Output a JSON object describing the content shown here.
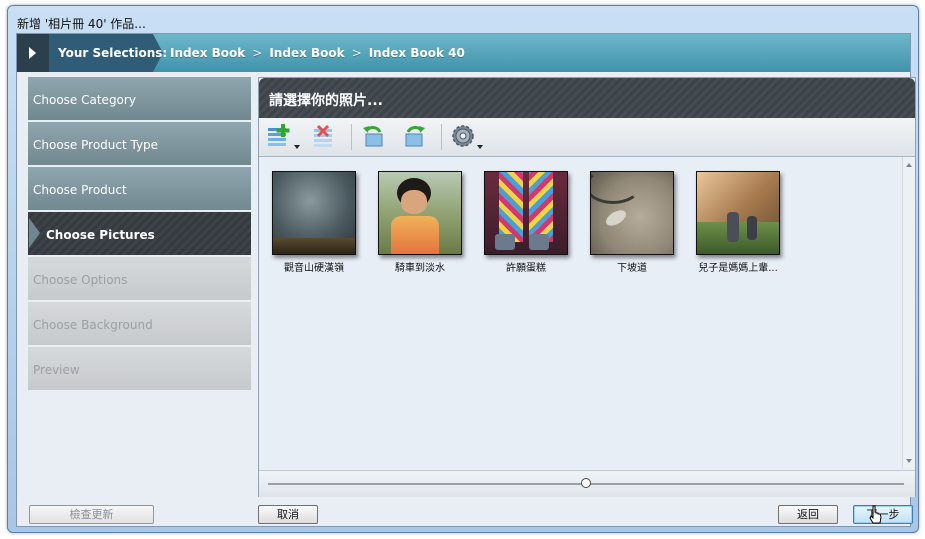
{
  "window": {
    "title": "新增 '相片冊 40' 作品..."
  },
  "breadcrumb": {
    "label": "Your Selections:",
    "items": [
      "Index Book",
      "Index Book",
      "Index Book 40"
    ],
    "separator": ">"
  },
  "sidebar": {
    "steps": [
      {
        "label": "Choose Category",
        "state": "done"
      },
      {
        "label": "Choose Product Type",
        "state": "done"
      },
      {
        "label": "Choose Product",
        "state": "done"
      },
      {
        "label": "Choose Pictures",
        "state": "current"
      },
      {
        "label": "Choose Options",
        "state": "future"
      },
      {
        "label": "Choose Background",
        "state": "future"
      },
      {
        "label": "Preview",
        "state": "future"
      }
    ],
    "check_update_label": "檢查更新"
  },
  "panel": {
    "title": "請選擇你的照片...",
    "toolbar": {
      "icons": [
        "add-photo-icon",
        "remove-photo-icon",
        "rotate-left-icon",
        "rotate-right-icon",
        "settings-gear-icon"
      ]
    },
    "photos": [
      {
        "caption": "觀音山硬漢嶺"
      },
      {
        "caption": "騎車到淡水"
      },
      {
        "caption": "許願蛋糕"
      },
      {
        "caption": "下坡道"
      },
      {
        "caption": "兒子是媽媽上輩..."
      }
    ]
  },
  "buttons": {
    "cancel": "取消",
    "back": "返回",
    "next": "下一步"
  },
  "colors": {
    "accent": "#3f93ab",
    "header_dark": "#3d4349"
  }
}
